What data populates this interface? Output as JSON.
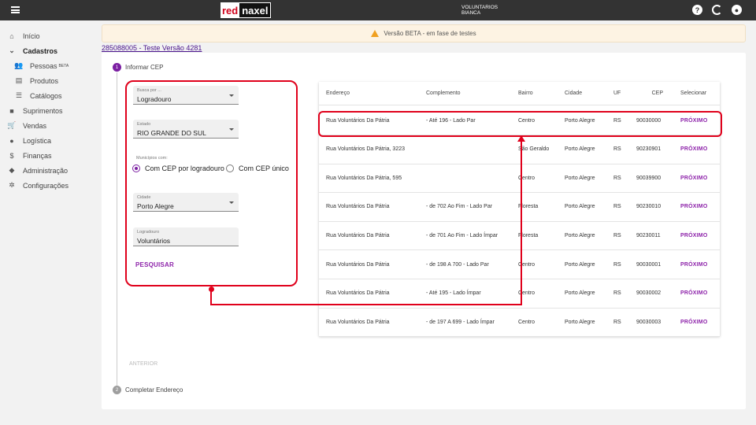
{
  "topbar": {
    "user_line1": "VOLUNTARIOS",
    "user_line2": "BIANCA",
    "logo_red": "red",
    "logo_dark": "naxel",
    "help_icon": "?",
    "refresh_icon": "C"
  },
  "sidebar": {
    "items": [
      {
        "label": "Início",
        "icon": "home-icon",
        "glyph": "⌂"
      },
      {
        "label": "Cadastros",
        "icon": "chevron-down-icon",
        "glyph": "⌄"
      },
      {
        "label": "Pessoas",
        "icon": "people-icon",
        "glyph": "👥",
        "badge": "BETA"
      },
      {
        "label": "Produtos",
        "icon": "products-icon",
        "glyph": "▤"
      },
      {
        "label": "Catálogos",
        "icon": "list-icon",
        "glyph": "☰"
      },
      {
        "label": "Suprimentos",
        "icon": "briefcase-icon",
        "glyph": "■"
      },
      {
        "label": "Vendas",
        "icon": "cart-icon",
        "glyph": "🛒"
      },
      {
        "label": "Logística",
        "icon": "truck-icon",
        "glyph": "●"
      },
      {
        "label": "Finanças",
        "icon": "dollar-icon",
        "glyph": "$"
      },
      {
        "label": "Administração",
        "icon": "shield-icon",
        "glyph": "◆"
      },
      {
        "label": "Configurações",
        "icon": "gear-icon",
        "glyph": "✲"
      }
    ]
  },
  "banner": {
    "text": "Versão BETA - em fase de testes"
  },
  "doc_link": "285088005 - Teste Versão 4281",
  "steps": {
    "step1": {
      "number": "1",
      "label": "Informar CEP"
    },
    "step2": {
      "number": "2",
      "label": "Completar Endereço"
    }
  },
  "form": {
    "busca": {
      "label": "Busca por ...",
      "value": "Logradouro"
    },
    "estado": {
      "label": "Estado",
      "value": "RIO GRANDE DO SUL"
    },
    "municipios_label": "Municípios com:",
    "radio_logradouro": "Com CEP por logradouro",
    "radio_unico": "Com CEP único",
    "cidade": {
      "label": "Cidade",
      "value": "Porto Alegre"
    },
    "logradouro": {
      "label": "Logradouro",
      "value": "Voluntários"
    },
    "search_button": "PESQUISAR",
    "prev_button": "ANTERIOR"
  },
  "table": {
    "headers": [
      "Endereço",
      "Complemento",
      "Bairro",
      "Cidade",
      "UF",
      "CEP",
      "Selecionar"
    ],
    "rows": [
      [
        "Rua Voluntários Da Pátria",
        "- Até 196 - Lado Par",
        "Centro",
        "Porto Alegre",
        "RS",
        "90030000",
        "PRÓXIMO"
      ],
      [
        "Rua Voluntários Da Pátria, 3223",
        "",
        "São Geraldo",
        "Porto Alegre",
        "RS",
        "90230901",
        "PRÓXIMO"
      ],
      [
        "Rua Voluntários Da Pátria, 595",
        "",
        "Centro",
        "Porto Alegre",
        "RS",
        "90039900",
        "PRÓXIMO"
      ],
      [
        "Rua Voluntários Da Pátria",
        "- de 702 Ao Fim - Lado Par",
        "Floresta",
        "Porto Alegre",
        "RS",
        "90230010",
        "PRÓXIMO"
      ],
      [
        "Rua Voluntários Da Pátria",
        "- de 701 Ao Fim - Lado Ímpar",
        "Floresta",
        "Porto Alegre",
        "RS",
        "90230011",
        "PRÓXIMO"
      ],
      [
        "Rua Voluntários Da Pátria",
        "- de 198 A 700 - Lado Par",
        "Centro",
        "Porto Alegre",
        "RS",
        "90030001",
        "PRÓXIMO"
      ],
      [
        "Rua Voluntários Da Pátria",
        "- Até 195 - Lado Ímpar",
        "Centro",
        "Porto Alegre",
        "RS",
        "90030002",
        "PRÓXIMO"
      ],
      [
        "Rua Voluntários Da Pátria",
        "- de 197 A 699 - Lado Ímpar",
        "Centro",
        "Porto Alegre",
        "RS",
        "90030003",
        "PRÓXIMO"
      ]
    ]
  },
  "colors": {
    "accent": "#8e24aa",
    "annotation": "#e0001b",
    "topbar": "#333333",
    "step_active": "#7b1fa2",
    "step_inactive": "#9e9e9e"
  }
}
